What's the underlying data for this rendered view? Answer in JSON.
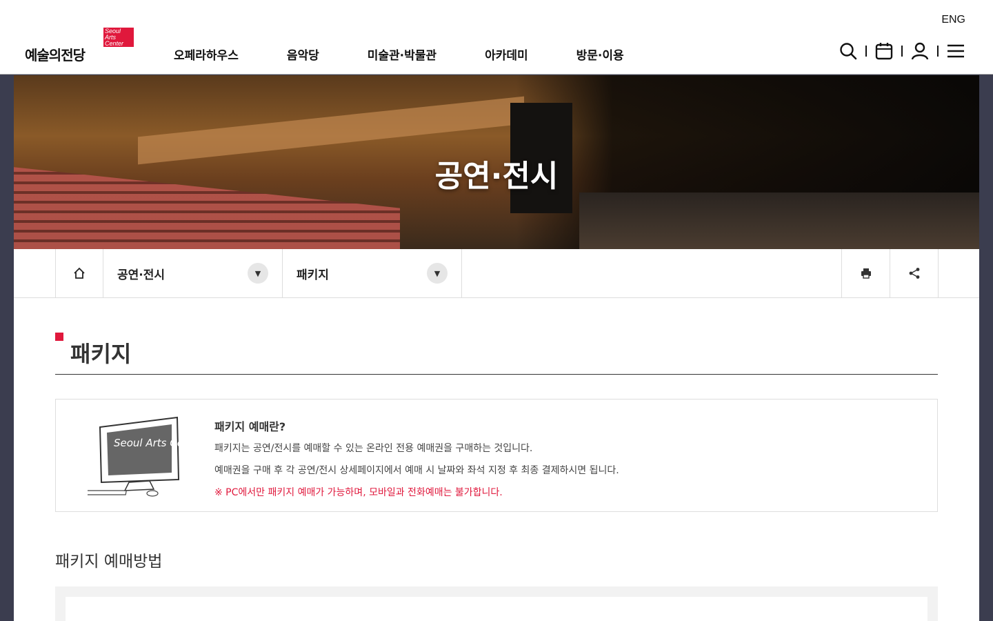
{
  "header": {
    "lang_label": "ENG",
    "logo_text": "예술의전당",
    "logo_badge": "Seoul Arts Center",
    "nav": [
      "오페라하우스",
      "음악당",
      "미술관·박물관",
      "아카데미",
      "방문·이용"
    ],
    "icons": [
      "search-icon",
      "calendar-icon",
      "user-icon",
      "menu-icon"
    ]
  },
  "hero": {
    "title": "공연·전시"
  },
  "breadcrumb": {
    "level1": "공연·전시",
    "level2": "패키지",
    "tools": [
      "print-icon",
      "share-icon"
    ]
  },
  "main": {
    "title": "패키지",
    "info": {
      "heading": "패키지 예매란?",
      "line1": "패키지는 공연/전시를 예매할 수 있는 온라인 전용 예매권을 구매하는 것입니다.",
      "line2": "예매권을 구매 후 각 공연/전시 상세페이지에서 예매 시 날짜와 좌석 지정 후 최종 결제하시면 됩니다.",
      "notice": "※ PC에서만 패키지 예매가 가능하며, 모바일과 전화예매는 불가합니다.",
      "image_text": "Seoul Arts Center"
    },
    "subtitle": "패키지 예매방법"
  },
  "colors": {
    "accent": "#e0183c",
    "sidebar_bg": "#3b3d4f"
  }
}
